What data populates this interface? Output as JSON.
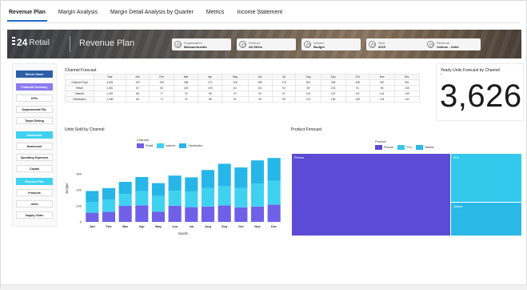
{
  "tabs": [
    {
      "label": "Revenue Plan",
      "active": true
    },
    {
      "label": "Margin Analysis",
      "active": false
    },
    {
      "label": "Margin Detail Analysis by Quarter",
      "active": false
    },
    {
      "label": "Metrics",
      "active": false
    },
    {
      "label": "Income Statement",
      "active": false
    }
  ],
  "banner": {
    "logo_number": "24",
    "logo_word": "Retail",
    "title": "Revenue Plan",
    "filters": [
      {
        "label": "Organization",
        "value": "Massachusetts"
      },
      {
        "label": "Product",
        "value": "All SKUs"
      },
      {
        "label": "Version",
        "value": "Budget"
      },
      {
        "label": "Year",
        "value": "2019"
      },
      {
        "label": "Revenue",
        "value": "Volume - Units"
      }
    ]
  },
  "sidebar": {
    "items": [
      {
        "label": "Return Home",
        "style": "return"
      },
      {
        "label": "Financial Summary",
        "style": "purple"
      },
      {
        "label": "KPIs",
        "style": "plain"
      },
      {
        "label": "Departmental P&L",
        "style": "plain"
      },
      {
        "label": "Target Setting",
        "style": "plain"
      },
      {
        "label": "Dashboard",
        "style": "cyan"
      },
      {
        "label": "Headcount",
        "style": "plain"
      },
      {
        "label": "Operating Expenses",
        "style": "plain"
      },
      {
        "label": "Capital",
        "style": "plain"
      },
      {
        "label": "Revenue Plan",
        "style": "cyan"
      },
      {
        "label": "Products",
        "style": "plain"
      },
      {
        "label": "Units",
        "style": "plain"
      },
      {
        "label": "Supply Chain",
        "style": "plain"
      }
    ]
  },
  "channel_forecast": {
    "title": "Channel Forecast",
    "columns": [
      "Year",
      "Jan",
      "Feb",
      "Mar",
      "Apr",
      "May",
      "Jun",
      "Jul",
      "Aug",
      "Sep",
      "Oct",
      "Nov",
      "Dec"
    ],
    "rows": [
      {
        "label": "Channel Total",
        "values": [
          "3,626",
          "193",
          "199",
          "288",
          "272",
          "226",
          "289",
          "278",
          "304",
          "363",
          "348",
          "387",
          "391"
        ]
      },
      {
        "label": "Retail",
        "values": [
          "1,081",
          "57",
          "63",
          "100",
          "103",
          "64",
          "101",
          "92",
          "96",
          "103",
          "91",
          "96",
          "108"
        ]
      },
      {
        "label": "Internet",
        "values": [
          "1,287",
          "68",
          "77",
          "75",
          "89",
          "97",
          "93",
          "97",
          "115",
          "122",
          "121",
          "144",
          "149"
        ]
      },
      {
        "label": "Distribution",
        "values": [
          "1,258",
          "68",
          "71",
          "75",
          "88",
          "81",
          "95",
          "89",
          "113",
          "138",
          "128",
          "144",
          "142"
        ]
      }
    ]
  },
  "kpi": {
    "title": "Yearly Units Forecast by Channel",
    "subtitle": "∇",
    "value": "3,626"
  },
  "units_chart": {
    "title": "Units Sold by Channel",
    "legend_title": "Channel"
  },
  "product_forecast": {
    "title": "Product Forecast",
    "legend_title": "Product",
    "cells": [
      {
        "label": "Phones",
        "color": "#5b4bd6"
      },
      {
        "label": "PCs",
        "color": "#33c9ec"
      },
      {
        "label": "Tablets",
        "color": "#2ab8e6"
      }
    ]
  },
  "colors": {
    "retail": "#7060e8",
    "internet": "#3fd2f0",
    "distribution": "#27b6e8",
    "accent": "#1b6bd1"
  },
  "chart_data": [
    {
      "type": "bar",
      "stacked": true,
      "title": "Units Sold by Channel",
      "xlabel": "Month",
      "ylabel": "Budget",
      "categories": [
        "Jan",
        "Feb",
        "Mar",
        "Apr",
        "May",
        "Jun",
        "Jul",
        "Aug",
        "Sep",
        "Oct",
        "Nov",
        "Dec"
      ],
      "series": [
        {
          "name": "Retail",
          "color": "#7060e8",
          "values": [
            57,
            63,
            100,
            103,
            64,
            101,
            92,
            96,
            103,
            91,
            96,
            108
          ]
        },
        {
          "name": "Internet",
          "color": "#3fd2f0",
          "values": [
            68,
            77,
            75,
            89,
            97,
            93,
            97,
            115,
            122,
            121,
            144,
            149
          ]
        },
        {
          "name": "Distribution",
          "color": "#27b6e8",
          "values": [
            68,
            71,
            75,
            88,
            81,
            95,
            89,
            113,
            138,
            128,
            144,
            142
          ]
        }
      ],
      "yticks": [
        0,
        100,
        200,
        300
      ],
      "ylim": [
        0,
        420
      ],
      "legend": "top"
    },
    {
      "type": "treemap",
      "title": "Product Forecast",
      "series": [
        {
          "name": "Phones",
          "color": "#5b4bd6",
          "value": 0.54
        },
        {
          "name": "PCs",
          "color": "#33c9ec",
          "value": 0.27
        },
        {
          "name": "Tablets",
          "color": "#2ab8e6",
          "value": 0.19
        }
      ],
      "legend": "top"
    }
  ]
}
